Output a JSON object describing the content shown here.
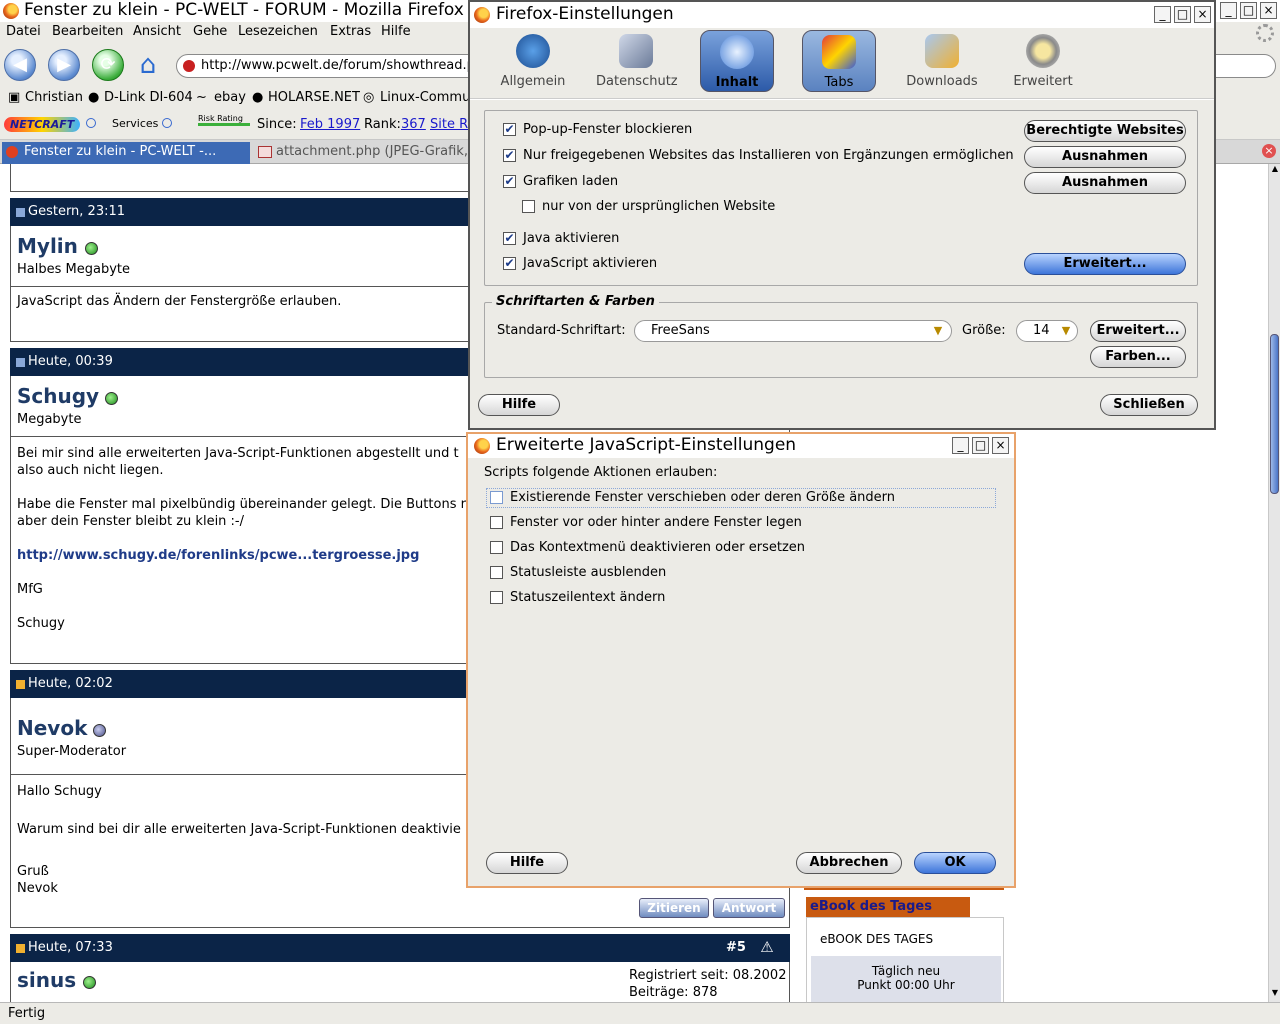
{
  "browser": {
    "title": "Fenster zu klein - PC-WELT - FORUM - Mozilla Firefox",
    "menu": [
      "Datei",
      "Bearbeiten",
      "Ansicht",
      "Gehe",
      "Lesezeichen",
      "Extras",
      "Hilfe"
    ],
    "url": "http://www.pcwelt.de/forum/showthread.php",
    "bookmarks": [
      "Christian",
      "D-Link DI-604",
      "ebay",
      "HOLARSE.NET",
      "Linux-Community"
    ],
    "netcraft": {
      "brand": "NETCRAFT",
      "services": "Services",
      "risk": "Risk Rating",
      "since_label": "Since:",
      "since_value": "Feb 1997",
      "rank_label": "Rank:",
      "rank_value": "367",
      "site_report": "Site Report"
    },
    "tabs": [
      "Fenster zu klein - PC-WELT -...",
      "attachment.php (JPEG-Grafik, ..."
    ],
    "status": "Fertig"
  },
  "posts": [
    {
      "date": "Gestern, 23:11",
      "user": "Mylin",
      "rank": "Halbes Megabyte",
      "lines": [
        "JavaScript das Ändern der Fenstergröße erlauben."
      ]
    },
    {
      "date": "Heute, 00:39",
      "user": "Schugy",
      "rank": "Megabyte",
      "lines": [
        "Bei mir sind alle erweiterten Java-Script-Funktionen abgestellt und t",
        "also auch nicht liegen.",
        "Habe die Fenster mal pixelbündig übereinander gelegt. Die Buttons re",
        "aber dein Fenster bleibt zu klein :-/"
      ],
      "link": "http://www.schugy.de/forenlinks/pcwe...tergroesse.jpg",
      "sign1": "MfG",
      "sign2": "Schugy"
    },
    {
      "date": "Heute, 02:02",
      "user": "Nevok",
      "rank": "Super-Moderator",
      "lines": [
        "Hallo Schugy",
        "Warum sind bei dir alle erweiterten Java-Script-Funktionen deaktivie",
        "Gruß",
        "Nevok"
      ],
      "quote_btn": "Zitieren",
      "reply_btn": "Antwort"
    },
    {
      "date": "Heute, 07:33",
      "user": "sinus",
      "post_no": "#5",
      "registered": "Registriert seit: 08.2002",
      "posts_count": "Beiträge: 878"
    }
  ],
  "sidebar": {
    "ebook_header": "eBook des Tages",
    "ebook_title": "eBOOK DES TAGES",
    "ebook_line1": "Täglich neu",
    "ebook_line2": "Punkt 00:00 Uhr"
  },
  "settings": {
    "title": "Firefox-Einstellungen",
    "categories": [
      "Allgemein",
      "Datenschutz",
      "Inhalt",
      "Tabs",
      "Downloads",
      "Erweitert"
    ],
    "options": [
      "Pop-up-Fenster blockieren",
      "Nur freigegebenen Websites das Installieren von Ergänzungen ermöglichen",
      "Grafiken laden",
      "nur von der ursprünglichen Website",
      "Java aktivieren",
      "JavaScript aktivieren"
    ],
    "btn_allowed_sites": "Berechtigte Websites",
    "btn_exceptions": "Ausnahmen",
    "btn_advanced": "Erweitert...",
    "fonts_group": "Schriftarten & Farben",
    "default_font_label": "Standard-Schriftart:",
    "default_font": "FreeSans",
    "size_label": "Größe:",
    "size": "14",
    "btn_colors": "Farben...",
    "btn_help": "Hilfe",
    "btn_close": "Schließen"
  },
  "jsdialog": {
    "title": "Erweiterte JavaScript-Einstellungen",
    "intro": "Scripts folgende Aktionen erlauben:",
    "options": [
      "Existierende Fenster verschieben oder deren Größe ändern",
      "Fenster vor oder hinter andere Fenster legen",
      "Das Kontextmenü deaktivieren oder ersetzen",
      "Statusleiste ausblenden",
      "Statuszeilentext ändern"
    ],
    "btn_help": "Hilfe",
    "btn_cancel": "Abbrechen",
    "btn_ok": "OK"
  }
}
